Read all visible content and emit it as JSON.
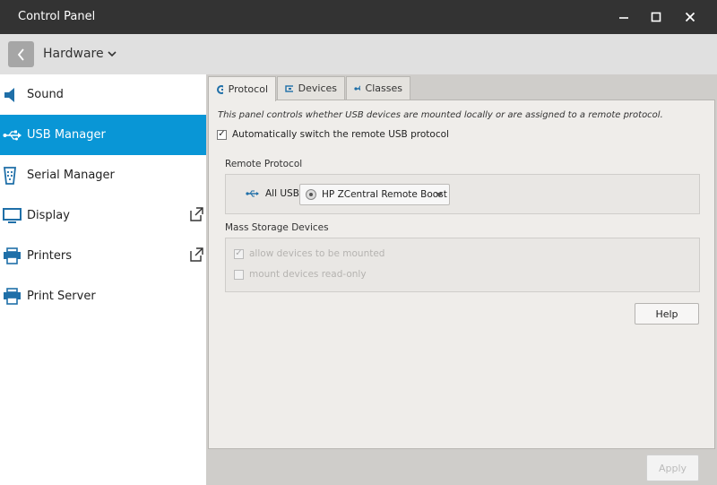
{
  "window": {
    "title": "Control Panel"
  },
  "navbar": {
    "breadcrumb": "Hardware"
  },
  "sidebar": {
    "items": [
      {
        "label": "Sound",
        "icon": "speaker-icon",
        "active": false,
        "external": false
      },
      {
        "label": "USB Manager",
        "icon": "usb-icon",
        "active": true,
        "external": false
      },
      {
        "label": "Serial Manager",
        "icon": "serial-port-icon",
        "active": false,
        "external": false
      },
      {
        "label": "Display",
        "icon": "monitor-icon",
        "active": false,
        "external": true
      },
      {
        "label": "Printers",
        "icon": "printer-icon",
        "active": false,
        "external": true
      },
      {
        "label": "Print Server",
        "icon": "print-server-icon",
        "active": false,
        "external": false
      }
    ]
  },
  "tabs": [
    {
      "label": "Protocol",
      "icon": "protocol-icon",
      "active": true
    },
    {
      "label": "Devices",
      "icon": "devices-icon",
      "active": false
    },
    {
      "label": "Classes",
      "icon": "usb-icon",
      "active": false
    }
  ],
  "protocol": {
    "description": "This panel controls whether USB devices are mounted locally or are assigned to a remote protocol.",
    "auto_switch_label": "Automatically switch the remote USB protocol",
    "auto_switch_checked": true,
    "remote_protocol_heading": "Remote Protocol",
    "all_usb_label": "All USB",
    "protocol_value": "HP ZCentral Remote Boost",
    "mass_storage_heading": "Mass Storage Devices",
    "allow_mount_label": "allow devices to be mounted",
    "allow_mount_checked": true,
    "read_only_label": "mount devices read-only",
    "read_only_checked": false
  },
  "buttons": {
    "help": "Help",
    "apply": "Apply"
  },
  "colors": {
    "titlebar": "#333333",
    "accent": "#0996d6",
    "icon_blue": "#1f6fa8"
  }
}
